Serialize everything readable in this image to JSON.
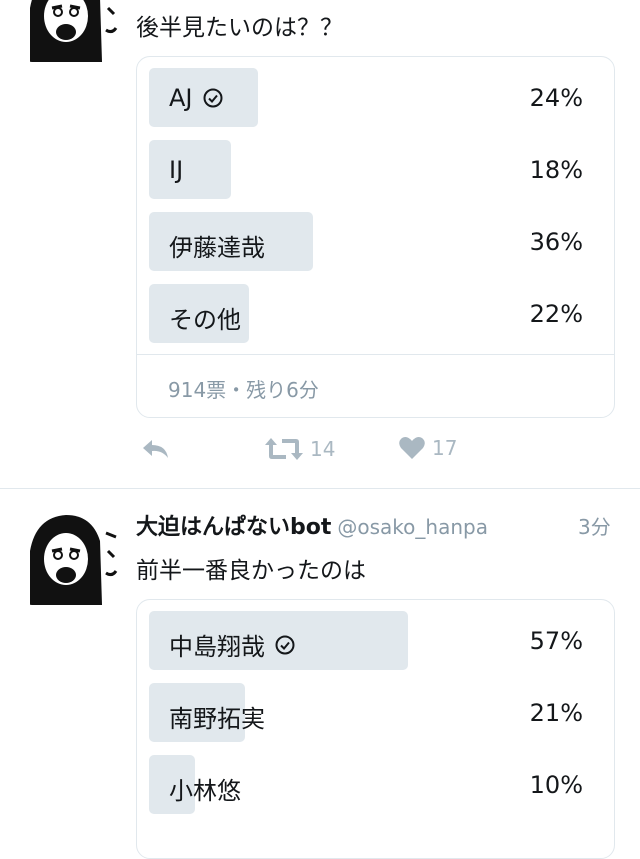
{
  "tweet1": {
    "text": "後半見たいのは？？",
    "poll": {
      "options": [
        {
          "label": "AJ",
          "percent": "24%",
          "share": 0.24,
          "selected": true
        },
        {
          "label": "IJ",
          "percent": "18%",
          "share": 0.18,
          "selected": false
        },
        {
          "label": "伊藤達哉",
          "percent": "36%",
          "share": 0.36,
          "selected": false
        },
        {
          "label": "その他",
          "percent": "22%",
          "share": 0.22,
          "selected": false
        }
      ],
      "footer": "914票・残り6分"
    },
    "actions": {
      "retweets": "14",
      "likes": "17"
    }
  },
  "tweet2": {
    "display_name": "大迫はんぱないbot",
    "handle": "@osako_hanpa",
    "time": "3分",
    "text": "前半一番良かったのは",
    "poll": {
      "options": [
        {
          "label": "中島翔哉",
          "percent": "57%",
          "share": 0.57,
          "selected": true
        },
        {
          "label": "南野拓実",
          "percent": "21%",
          "share": 0.21,
          "selected": false
        },
        {
          "label": "小林悠",
          "percent": "10%",
          "share": 0.1,
          "selected": false
        }
      ]
    }
  },
  "colors": {
    "bar": "#e1e8ed",
    "muted": "#8899a6",
    "text": "#14171a"
  }
}
